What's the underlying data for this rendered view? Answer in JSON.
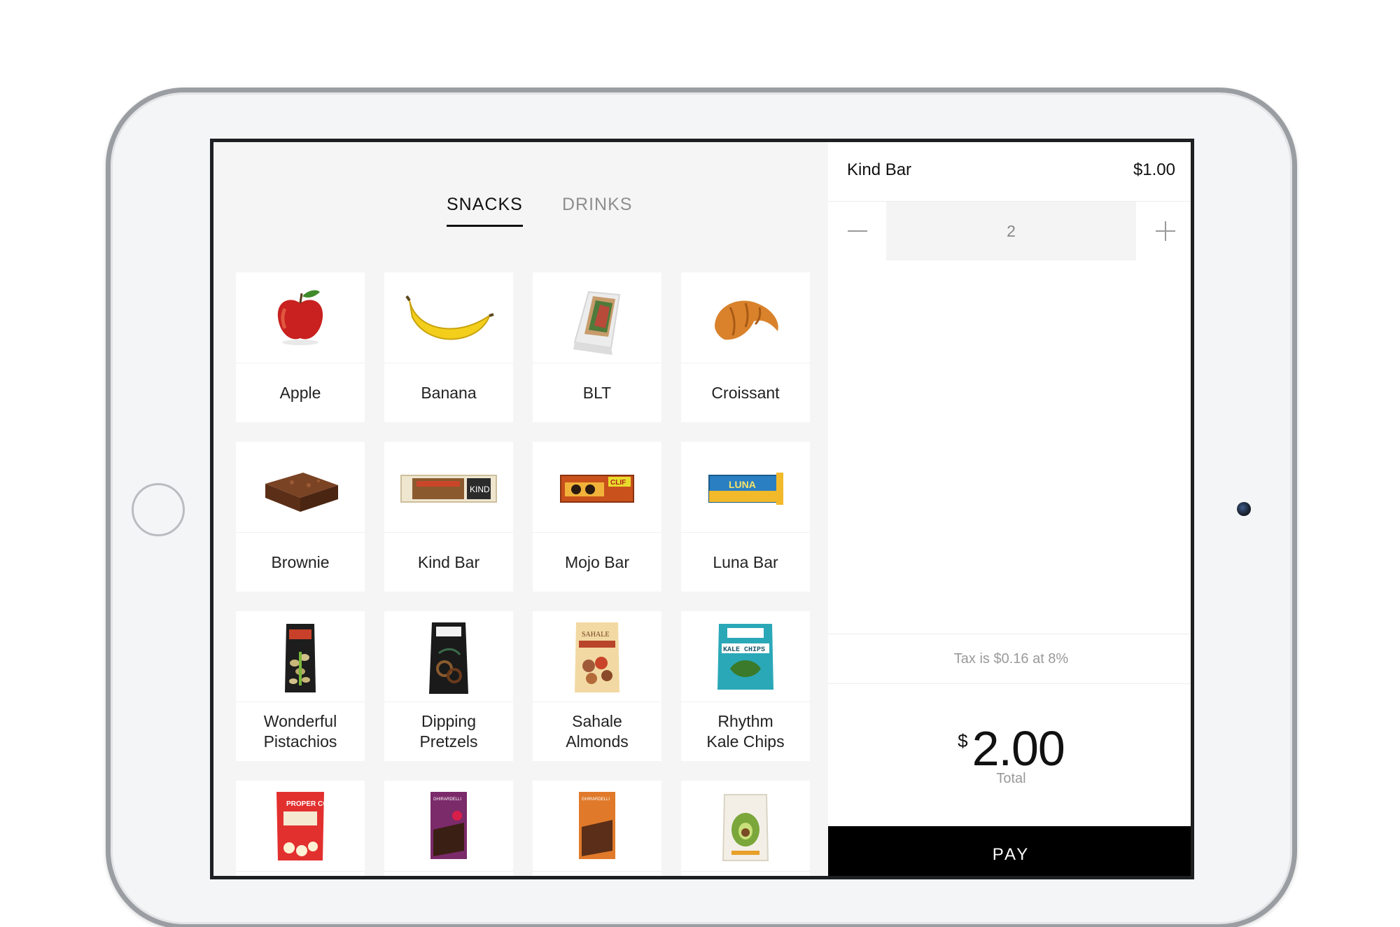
{
  "tabs": [
    {
      "label": "SNACKS",
      "active": true
    },
    {
      "label": "DRINKS",
      "active": false
    }
  ],
  "products": [
    {
      "label": "Apple",
      "image": "apple"
    },
    {
      "label": "Banana",
      "image": "banana"
    },
    {
      "label": "BLT",
      "image": "sandwich"
    },
    {
      "label": "Croissant",
      "image": "croissant"
    },
    {
      "label": "Brownie",
      "image": "brownie"
    },
    {
      "label": "Kind Bar",
      "image": "kind-bar",
      "wrapper_text": "KIND"
    },
    {
      "label": "Mojo Bar",
      "image": "mojo-bar",
      "wrapper_text": "CLIF"
    },
    {
      "label": "Luna Bar",
      "image": "luna-bar",
      "wrapper_text": "LUNA"
    },
    {
      "label": "Wonderful\nPistachios",
      "image": "pistachios-bag"
    },
    {
      "label": "Dipping\nPretzels",
      "image": "pretzels-bag"
    },
    {
      "label": "Sahale\nAlmonds",
      "image": "almonds-bag",
      "wrapper_text": "SAHALE"
    },
    {
      "label": "Rhythm\nKale Chips",
      "image": "kale-chips-bag",
      "wrapper_text": "KALE CHIPS"
    },
    {
      "label": "",
      "image": "popcorn-bag",
      "wrapper_text": "PROPER CORN"
    },
    {
      "label": "",
      "image": "chocolate-raspberry",
      "wrapper_text": "GHIRARDELLI"
    },
    {
      "label": "",
      "image": "chocolate-caramel",
      "wrapper_text": "GHIRARDELLI"
    },
    {
      "label": "",
      "image": "avocado-bag"
    }
  ],
  "order": {
    "item_name": "Kind Bar",
    "item_price": "$1.00",
    "quantity": "2",
    "minus_icon": "minus-icon",
    "plus_icon": "plus-icon"
  },
  "summary": {
    "tax_text": "Tax is $0.16 at 8%",
    "currency": "$",
    "total": "2.00",
    "total_label": "Total"
  },
  "pay_label": "PAY",
  "colors": {
    "screen_bg": "#f5f5f5",
    "card_bg": "#ffffff",
    "pay_bg": "#000000",
    "text_primary": "#111111",
    "text_muted": "#8e8e8e"
  }
}
